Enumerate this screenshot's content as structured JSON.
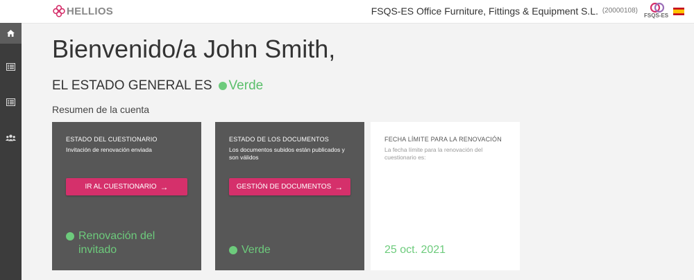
{
  "header": {
    "logo_text": "HELLIOS",
    "company_name": "FSQS-ES Office Furniture, Fittings & Equipment S.L.",
    "company_id": "(20000108)",
    "badge_text": "FSQS-ES",
    "flag": "spain-flag-icon"
  },
  "sidebar": {
    "items": [
      {
        "icon": "home-icon",
        "active": true
      },
      {
        "icon": "list-icon",
        "active": false
      },
      {
        "icon": "list-icon",
        "active": false
      },
      {
        "icon": "users-icon",
        "active": false
      }
    ]
  },
  "main": {
    "welcome": "Bienvenido/a John Smith,",
    "status_label": "EL ESTADO GENERAL ES",
    "status_value": "Verde",
    "summary_title": "Resumen de la cuenta"
  },
  "cards": [
    {
      "title": "ESTADO DEL CUESTIONARIO",
      "description": "Invitación de renovación enviada",
      "button": "IR AL CUESTIONARIO",
      "status": "Renovación del invitado"
    },
    {
      "title": "ESTADO DE LOS DOCUMENTOS",
      "description": "Los documentos subidos están publicados y son válidos",
      "button": "GESTIÓN DE DOCUMENTOS",
      "status": "Verde"
    },
    {
      "title": "FECHA LÍMITE PARA LA RENOVACIÓN",
      "description": "La fecha límite para la renovación del cuestionario es:",
      "date": "25 oct. 2021"
    }
  ],
  "colors": {
    "accent": "#d5306b",
    "status_green": "#6dcb7c",
    "sidebar": "#3c3c3c",
    "card_dark": "#575757"
  }
}
